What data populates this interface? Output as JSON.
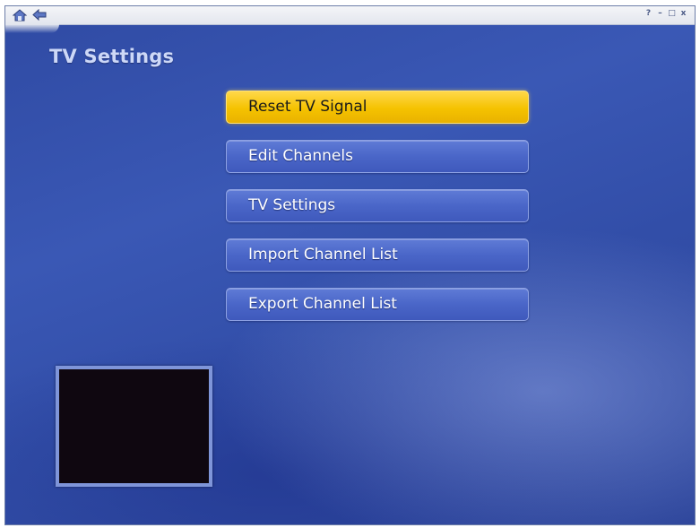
{
  "titlebar": {
    "nav_icons": [
      "home-icon",
      "back-icon"
    ],
    "window_controls": [
      {
        "icon": "help-icon",
        "glyph": "?"
      },
      {
        "icon": "minimize-icon",
        "glyph": "–"
      },
      {
        "icon": "restore-icon",
        "glyph": "□"
      },
      {
        "icon": "close-icon",
        "glyph": "x"
      }
    ]
  },
  "page": {
    "title": "TV Settings"
  },
  "menu": {
    "items": [
      {
        "label": "Reset TV Signal",
        "selected": true
      },
      {
        "label": "Edit Channels",
        "selected": false
      },
      {
        "label": "TV Settings",
        "selected": false
      },
      {
        "label": "Import Channel List",
        "selected": false
      },
      {
        "label": "Export Channel List",
        "selected": false
      }
    ]
  },
  "colors": {
    "background": "#3a58b5",
    "button": "#4a66c8",
    "button_selected": "#f5c200",
    "title_text": "#cdd8f7"
  }
}
